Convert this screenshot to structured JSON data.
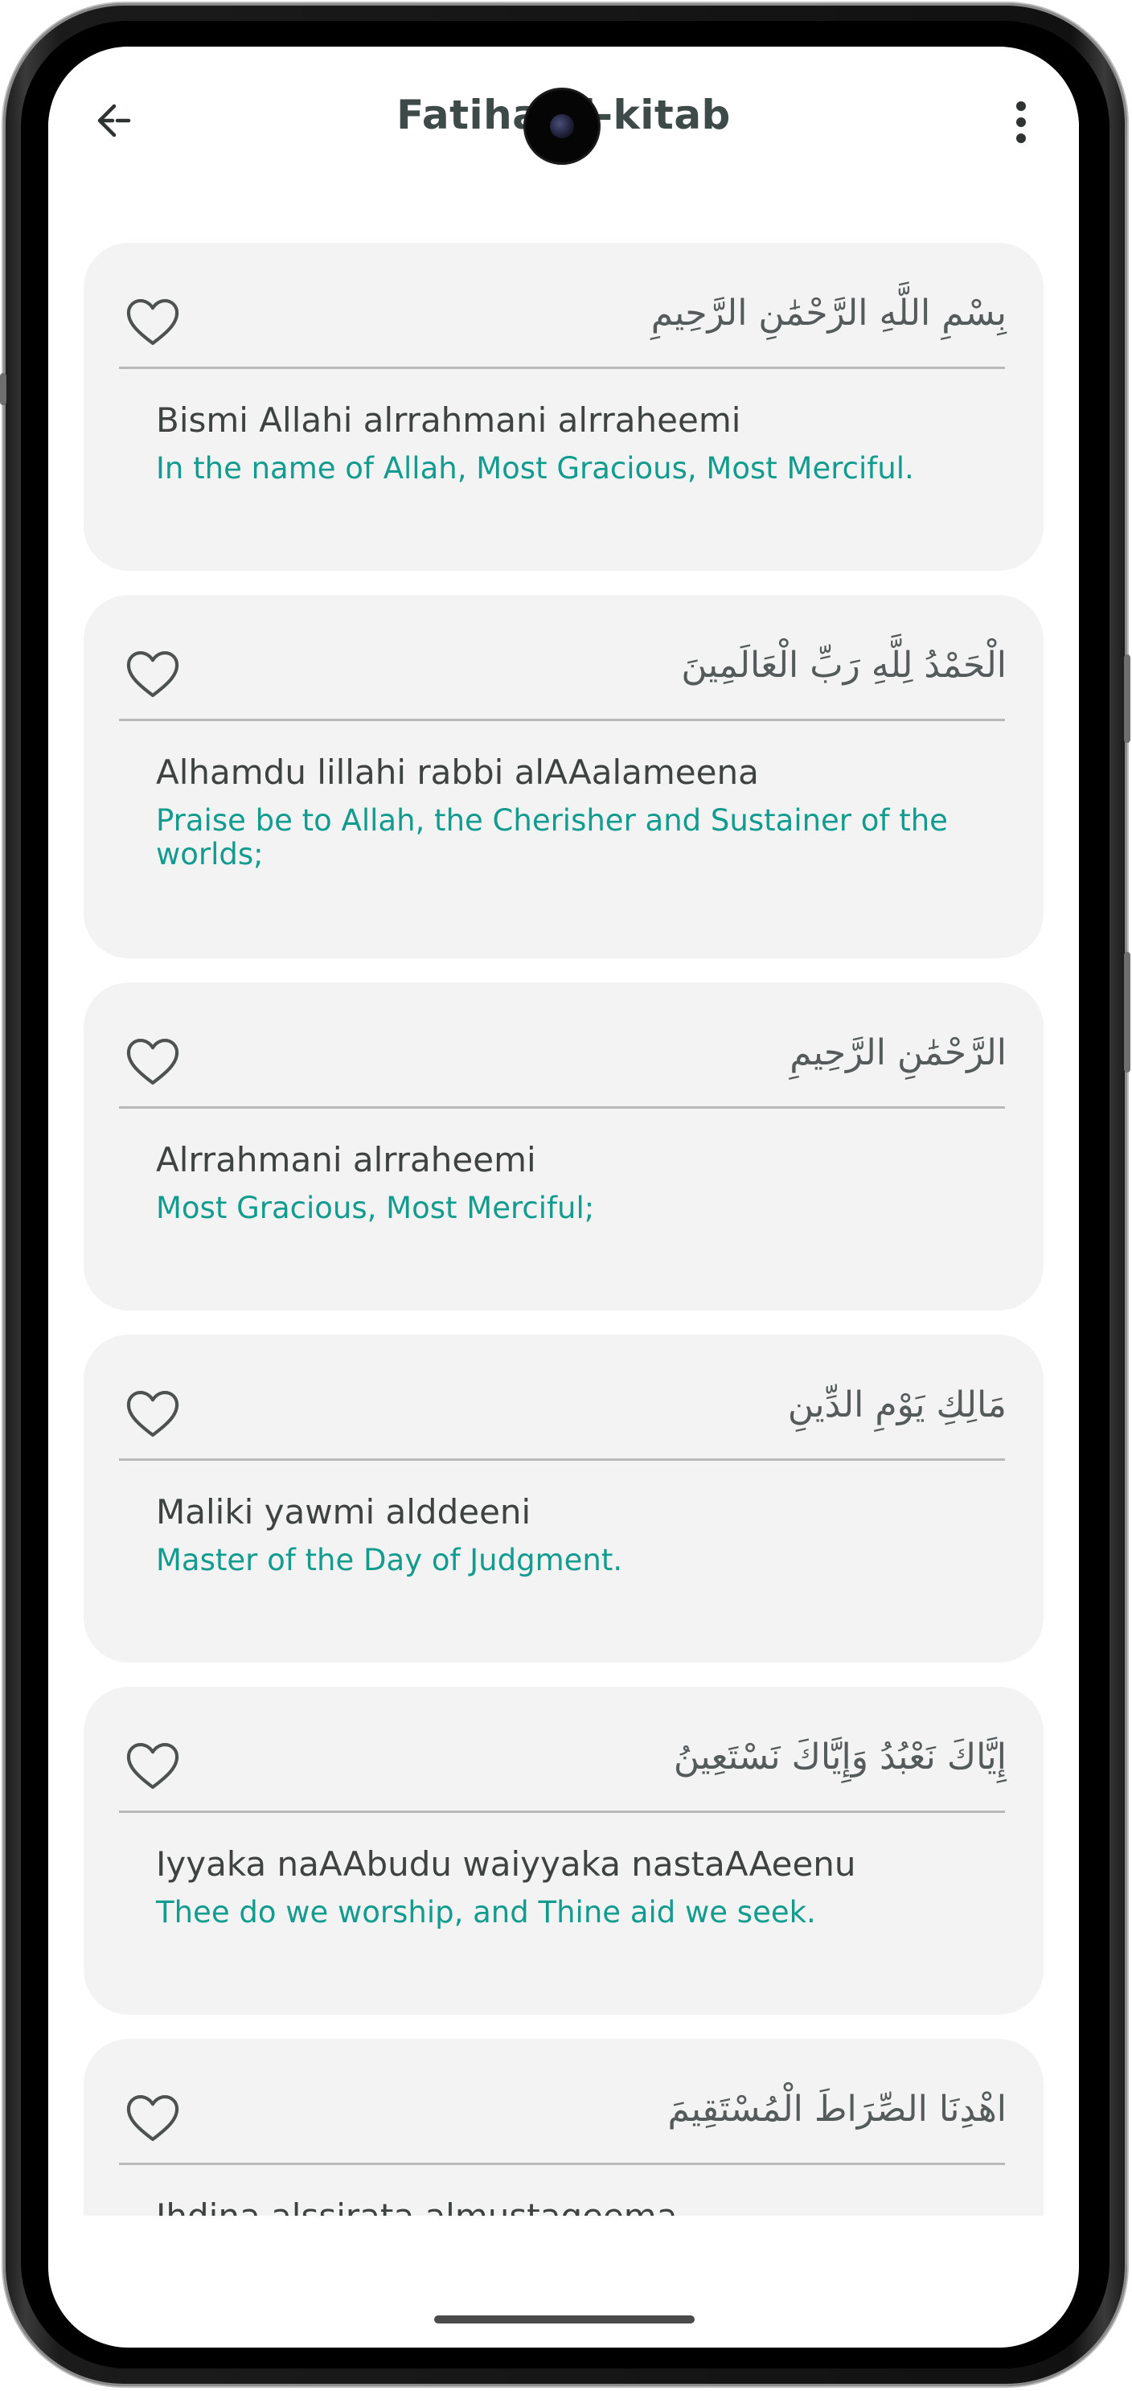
{
  "app": {
    "title": "Fatiha al-kitab"
  },
  "icons": {
    "back": "arrow-left-icon",
    "menu": "more-vertical-icon",
    "favorite": "heart-outline-icon"
  },
  "colors": {
    "card_background": "#f4f3f3",
    "translation_text": "#129c8f",
    "transliteration_text": "#3e4342",
    "arabic_text": "#555a5a",
    "title_text": "#3d4a48"
  },
  "verses": [
    {
      "arabic": "بِسْمِ اللَّهِ الرَّحْمَٰنِ الرَّحِيمِ",
      "transliteration": "Bismi Allahi alrrahmani alrraheemi",
      "translation": "In the name of Allah, Most Gracious, Most Merciful."
    },
    {
      "arabic": "الْحَمْدُ لِلَّهِ رَبِّ الْعَالَمِينَ",
      "transliteration": "Alhamdu lillahi rabbi alAAalameena",
      "translation": "Praise be to Allah, the Cherisher and Sustainer of the worlds;"
    },
    {
      "arabic": "الرَّحْمَٰنِ الرَّحِيمِ",
      "transliteration": "Alrrahmani alrraheemi",
      "translation": "Most Gracious, Most Merciful;"
    },
    {
      "arabic": "مَالِكِ يَوْمِ الدِّينِ",
      "transliteration": "Maliki yawmi alddeeni",
      "translation": "Master of the Day of Judgment."
    },
    {
      "arabic": "إِيَّاكَ نَعْبُدُ وَإِيَّاكَ نَسْتَعِينُ",
      "transliteration": "Iyyaka naAAbudu waiyyaka nastaAAeenu",
      "translation": "Thee do we worship, and Thine aid we seek."
    },
    {
      "arabic": "اهْدِنَا الصِّرَاطَ الْمُسْتَقِيمَ",
      "transliteration": "Ihdina alssirata almustaqeema",
      "translation": ""
    }
  ]
}
